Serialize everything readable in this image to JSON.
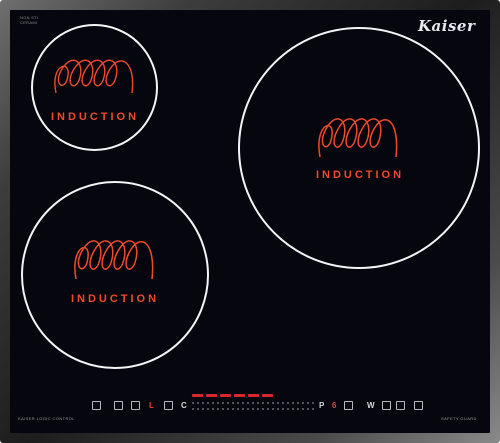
{
  "brand": {
    "name": "Kaiser"
  },
  "zones": [
    {
      "id": "top-left",
      "label": "INDUCTION"
    },
    {
      "id": "right",
      "label": "INDUCTION"
    },
    {
      "id": "bottom-left",
      "label": "INDUCTION"
    }
  ],
  "corner_text": {
    "line1": "NON STI",
    "line2": "CERAMI"
  },
  "control_panel": {
    "left_text": "KAISER LOGIC CONTROL",
    "right_text": "SAFETY GUARD",
    "lock_glyph": "L",
    "clock_glyph": "C",
    "p_glyph": "P",
    "six_glyph": "6",
    "w_glyph": "W",
    "heat_indicator_count": 6
  },
  "colors": {
    "glass": "#05060e",
    "zone_outline": "#f4f4f4",
    "induction_red": "#f04a2c",
    "heat_bar": "#d9282a"
  }
}
